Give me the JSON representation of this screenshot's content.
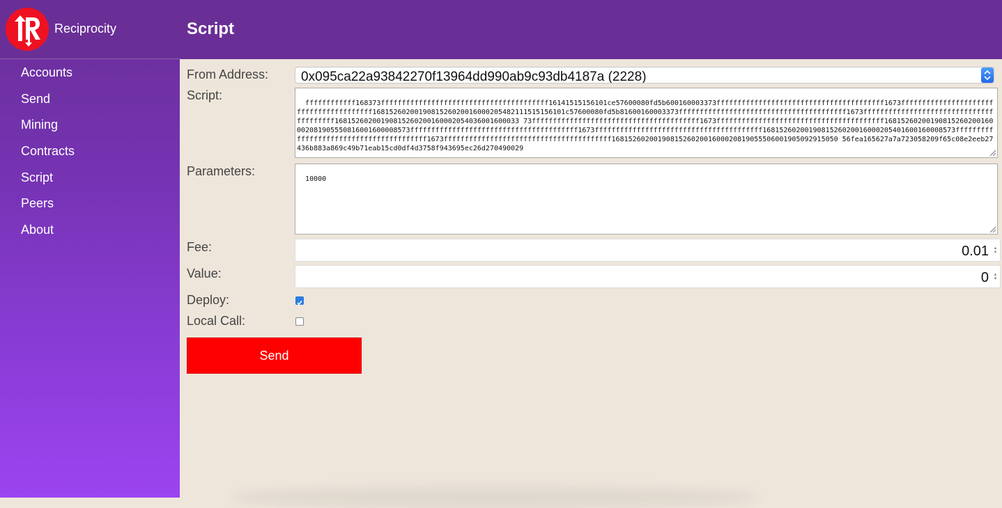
{
  "brand": {
    "name": "Reciprocity"
  },
  "nav": [
    {
      "label": "Accounts"
    },
    {
      "label": "Send"
    },
    {
      "label": "Mining"
    },
    {
      "label": "Contracts"
    },
    {
      "label": "Script"
    },
    {
      "label": "Peers"
    },
    {
      "label": "About"
    }
  ],
  "header": {
    "title": "Script"
  },
  "form": {
    "from_address_label": "From Address:",
    "from_address_value": "0x095ca22a93842270f13964dd990ab9c93db4187a (2228)",
    "script_label": "Script:",
    "script_value": "ffffffffffff168373ffffffffffffffffffffffffffffffffffffffff16141515156101ce57600080fd5b600160003373ffffffffffffffffffffffffffffffffffffffff1673ffffffffffffffffffffffffffffffffffffffff1681526020019081526020016000205482111515156101c57600080fd5b81600160003373ffffffffffffffffffffffffffffffffffffffff1673ffffffffffffffffffffffffffffffffffffffff16815260200190815260200160002054036001600033 73ffffffffffffffffffffffffffffffffffffffff1673ffffffffffffffffffffffffffffffffffffffff16815260200190815260200160002081905550816001600008573ffffffffffffffffffffffffffffffffffffffff1673ffffffffffffffffffffffffffffffffffffffff1681526020019081526020016000205401600160008573ffffffffffffffffffffffffffffffffffffffff1673ffffffffffffffffffffffffffffffffffffffff168152602001908152602001600020819055506001905092915050 56fea165627a7a723058209f65c08e2eeb27436b883a869c49b71eab15cd0df4d3758f943695ec26d270490029",
    "parameters_label": "Parameters:",
    "parameters_value": "10000",
    "fee_label": "Fee:",
    "fee_value": "0.01",
    "value_label": "Value:",
    "value_value": "0",
    "deploy_label": "Deploy:",
    "deploy_checked": true,
    "local_call_label": "Local Call:",
    "local_call_checked": false,
    "send_label": "Send"
  },
  "colors": {
    "header": "#6a2f96",
    "sidebar_bottom": "#9b44f0",
    "page_bg": "#eee6db",
    "send_button": "#ff0000",
    "logo": "#ee1122"
  },
  "icons": {
    "logo": "reciprocity-logo-icon",
    "select_arrow": "chevron-updown-icon",
    "resize": "resize-grip-icon"
  }
}
